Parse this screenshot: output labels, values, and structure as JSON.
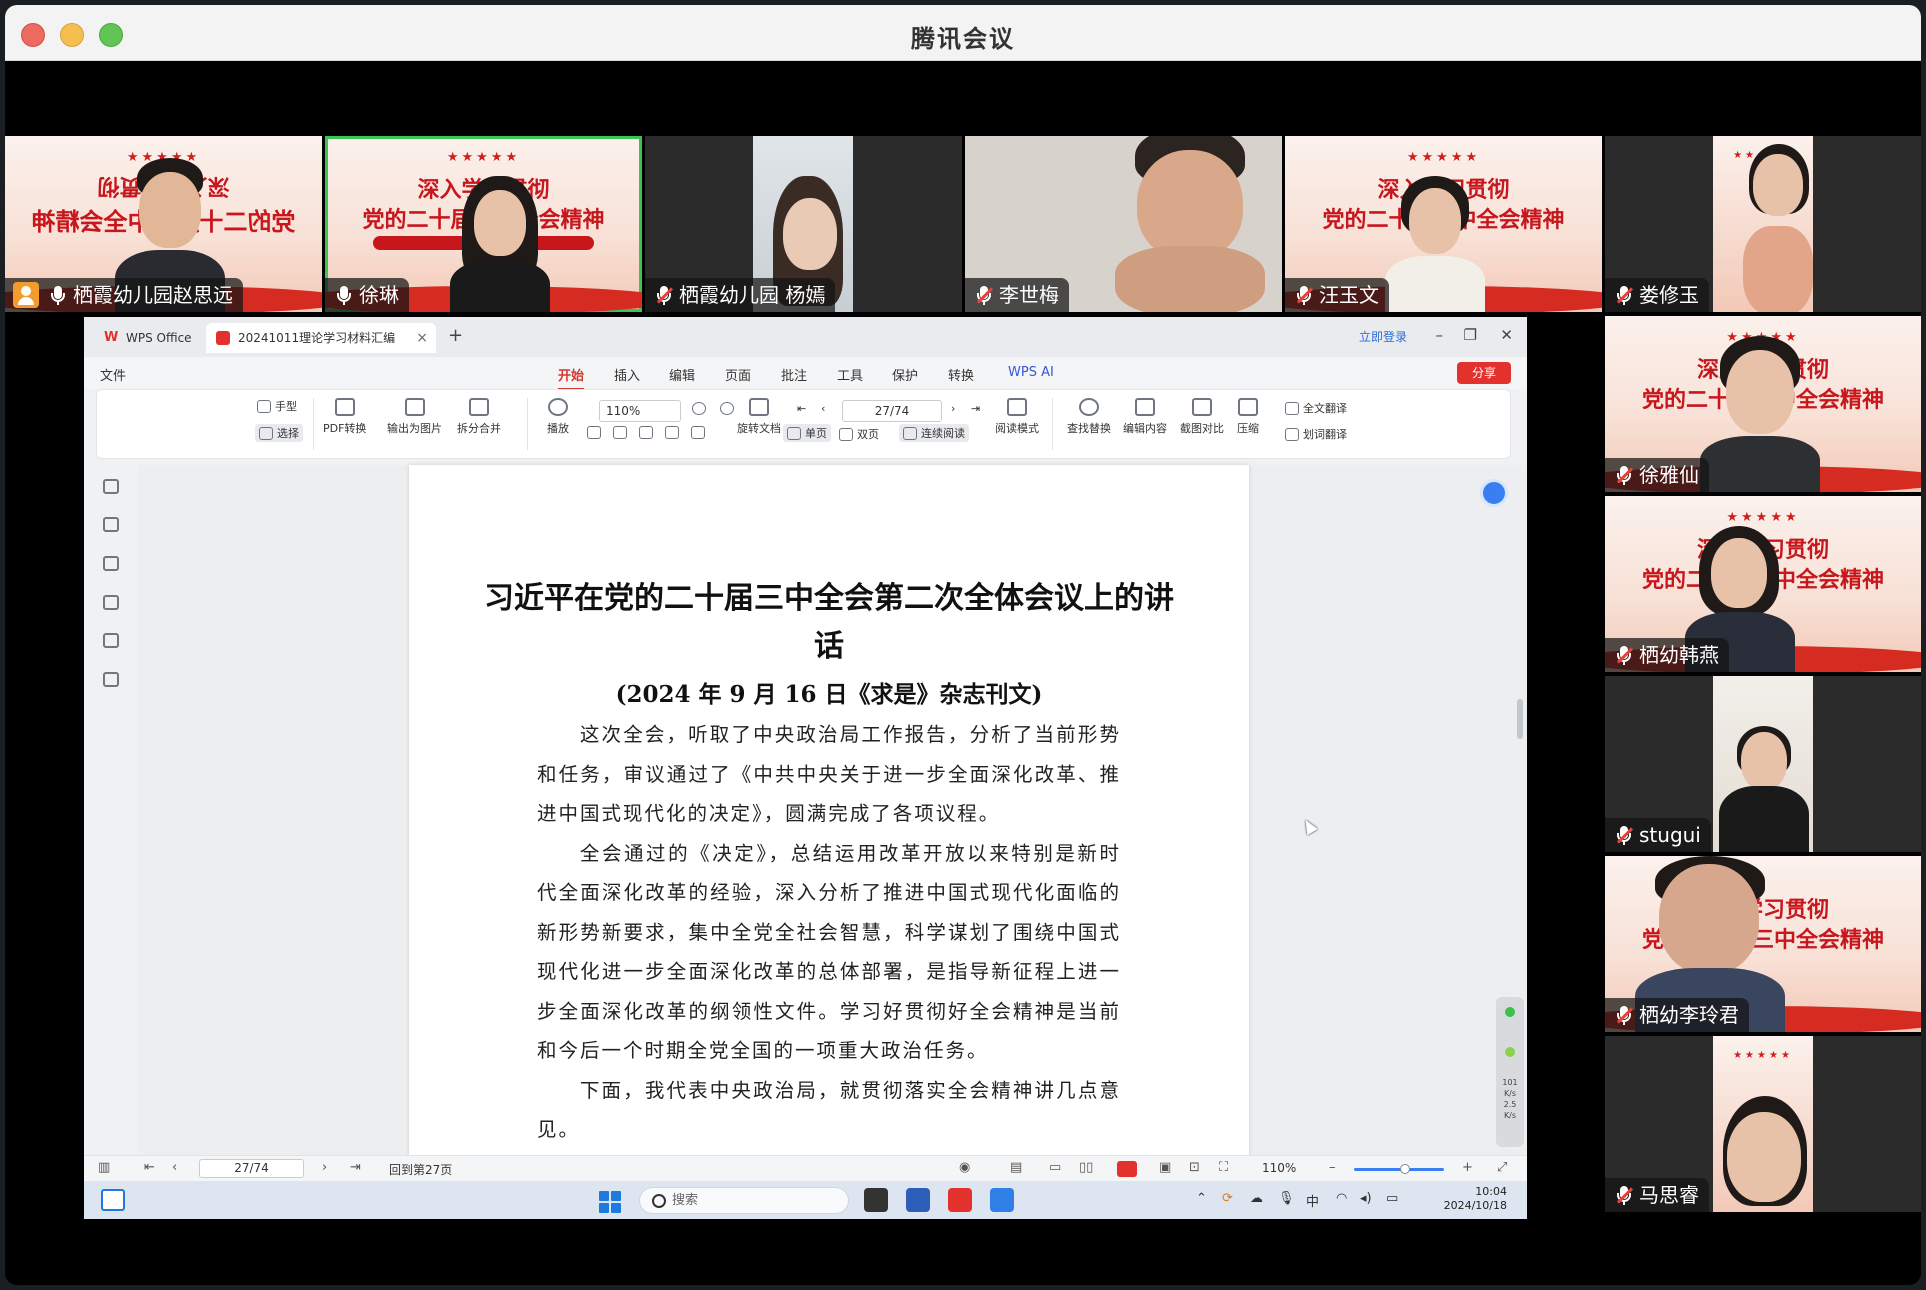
{
  "app": {
    "title": "腾讯会议"
  },
  "participants": [
    {
      "name": "栖霞幼儿园赵思远",
      "host": true,
      "muted": false
    },
    {
      "name": "徐琳",
      "host": false,
      "muted": false,
      "speaking": true
    },
    {
      "name": "栖霞幼儿园 杨嫣",
      "host": false,
      "muted": true
    },
    {
      "name": "李世梅",
      "host": false,
      "muted": true
    },
    {
      "name": "汪玉文",
      "host": false,
      "muted": true
    },
    {
      "name": "娄修玉",
      "host": false,
      "muted": true
    },
    {
      "name": "徐雅仙",
      "host": false,
      "muted": true
    },
    {
      "name": "栖幼韩燕",
      "host": false,
      "muted": true
    },
    {
      "name": "stugui",
      "host": false,
      "muted": true
    },
    {
      "name": "栖幼李玲君",
      "host": false,
      "muted": true
    },
    {
      "name": "马思睿",
      "host": false,
      "muted": true
    }
  ],
  "banner": {
    "line1": "深入学习贯彻",
    "line2": "党的二十届三中全会精神",
    "stars": "★★★★★"
  },
  "wps": {
    "tab_home": "WPS Office",
    "tab_doc": "20241011理论学习材料汇编",
    "login": "立即登录",
    "share": "分享",
    "menu": [
      "文件",
      "开始",
      "插入",
      "编辑",
      "页面",
      "批注",
      "工具",
      "保护",
      "转换",
      "WPS AI"
    ],
    "active_menu": "开始",
    "ribbon": {
      "hand": "手型",
      "select": "选择",
      "pdf_convert": "PDF转换",
      "export_image": "输出为图片",
      "split_merge": "拆分合并",
      "play": "播放",
      "zoom": "110%",
      "rotate": "旋转文档",
      "single": "单页",
      "double": "双页",
      "continuous": "连续阅读",
      "read_mode": "阅读模式",
      "find_replace": "查找替换",
      "edit_content": "编辑内容",
      "compare": "截图对比",
      "compress": "压缩",
      "full_translate": "全文翻译",
      "word_translate": "划词翻译",
      "page": "27/74"
    },
    "document": {
      "title": "习近平在党的二十届三中全会第二次全体会议上的讲话",
      "subtitle": "(2024 年 9 月 16 日《求是》杂志刊文)",
      "paragraphs": [
        "这次全会，听取了中央政治局工作报告，分析了当前形势和任务，审议通过了《中共中央关于进一步全面深化改革、推进中国式现代化的决定》，圆满完成了各项议程。",
        "全会通过的《决定》，总结运用改革开放以来特别是新时代全面深化改革的经验，深入分析了推进中国式现代化面临的新形势新要求，集中全党全社会智慧，科学谋划了围绕中国式现代化进一步全面深化改革的总体部署，是指导新征程上进一步全面深化改革的纲领性文件。学习好贯彻好全会精神是当前和今后一个时期全党全国的一项重大政治任务。",
        "下面，我代表中央政治局，就贯彻落实全会精神讲几点意见。"
      ]
    },
    "statusbar": {
      "page": "27/74",
      "back": "回到第27页",
      "zoom": "110%"
    },
    "side_widget": {
      "stats": "101\nK/s\n2.5\nK/s"
    }
  },
  "taskbar": {
    "search": "搜索",
    "ime": "中",
    "time": "10:04",
    "date": "2024/10/18"
  }
}
